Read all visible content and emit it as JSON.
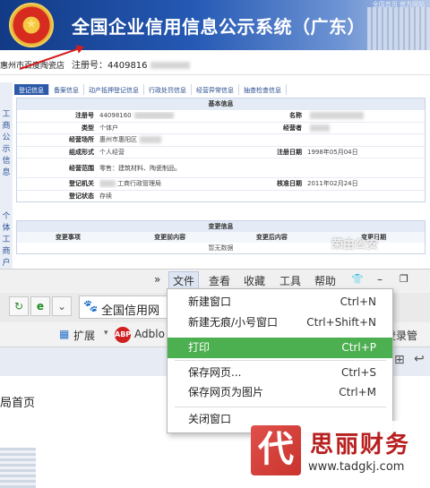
{
  "site": {
    "title": "全国企业信用信息公示系统（广东）",
    "top_links": "全国首页  官方网站",
    "company_name": "惠州市百度陶瓷店",
    "reg_label": "注册号：",
    "reg_value": "4409816"
  },
  "tabs": [
    "登记信息",
    "备案信息",
    "动产抵押登记信息",
    "行政处罚信息",
    "经营异常信息",
    "抽查检查信息"
  ],
  "sidebar_vertical": [
    "工",
    "商",
    "公",
    "示",
    "信",
    "息"
  ],
  "sidebar_vertical2": [
    "个",
    "体",
    "工",
    "商",
    "户",
    "公"
  ],
  "basic_info": {
    "header": "基本信息",
    "reg_no_label": "注册号",
    "reg_no_value": "44098160",
    "name_label": "名称",
    "type_label": "类型",
    "type_value": "个体户",
    "operator_label": "经营者",
    "address_label": "经营场所",
    "address_value": "惠州市惠阳区",
    "form_label": "组成形式",
    "form_value": "个人经营",
    "reg_date_label": "注册日期",
    "reg_date_value": "1998年05月04日",
    "scope_label": "经营范围",
    "scope_value": "零售：建筑材料、陶瓷制品。",
    "authority_label": "登记机关",
    "authority_value": "工商行政管理局",
    "approve_label": "核准日期",
    "approve_value": "2011年02月24日",
    "status_label": "登记状态",
    "status_value": "存续"
  },
  "change_info": {
    "header": "变更信息",
    "cols": [
      "变更事项",
      "变更前内容",
      "变更后内容",
      "变更日期"
    ],
    "empty": "暂无数据"
  },
  "watermark_top": "荣由公安",
  "menubar": {
    "more": "»",
    "file": "文件",
    "view": "查看",
    "favorites": "收藏",
    "tools": "工具",
    "help": "帮助"
  },
  "address_bar": {
    "text": "全国信用网"
  },
  "favorites_bar": {
    "ext": "扩展",
    "adblock": "Adblo",
    "login": "登录管"
  },
  "content": {
    "homepage": "局首页"
  },
  "file_menu": {
    "items": [
      {
        "label": "新建窗口",
        "shortcut": "Ctrl+N"
      },
      {
        "label": "新建无痕/小号窗口",
        "shortcut": "Ctrl+Shift+N"
      },
      {
        "label": "打印",
        "shortcut": "Ctrl+P"
      },
      {
        "label": "保存网页...",
        "shortcut": "Ctrl+S"
      },
      {
        "label": "保存网页为图片",
        "shortcut": "Ctrl+M"
      },
      {
        "label": "关闭窗口",
        "shortcut": ""
      }
    ]
  },
  "brand": {
    "logo_char": "代",
    "name": "思丽财务",
    "url": "www.tadgkj.com"
  },
  "colors": {
    "banner": "#2559b4",
    "highlight": "#4caf50",
    "brand_red": "#b81f1f"
  }
}
